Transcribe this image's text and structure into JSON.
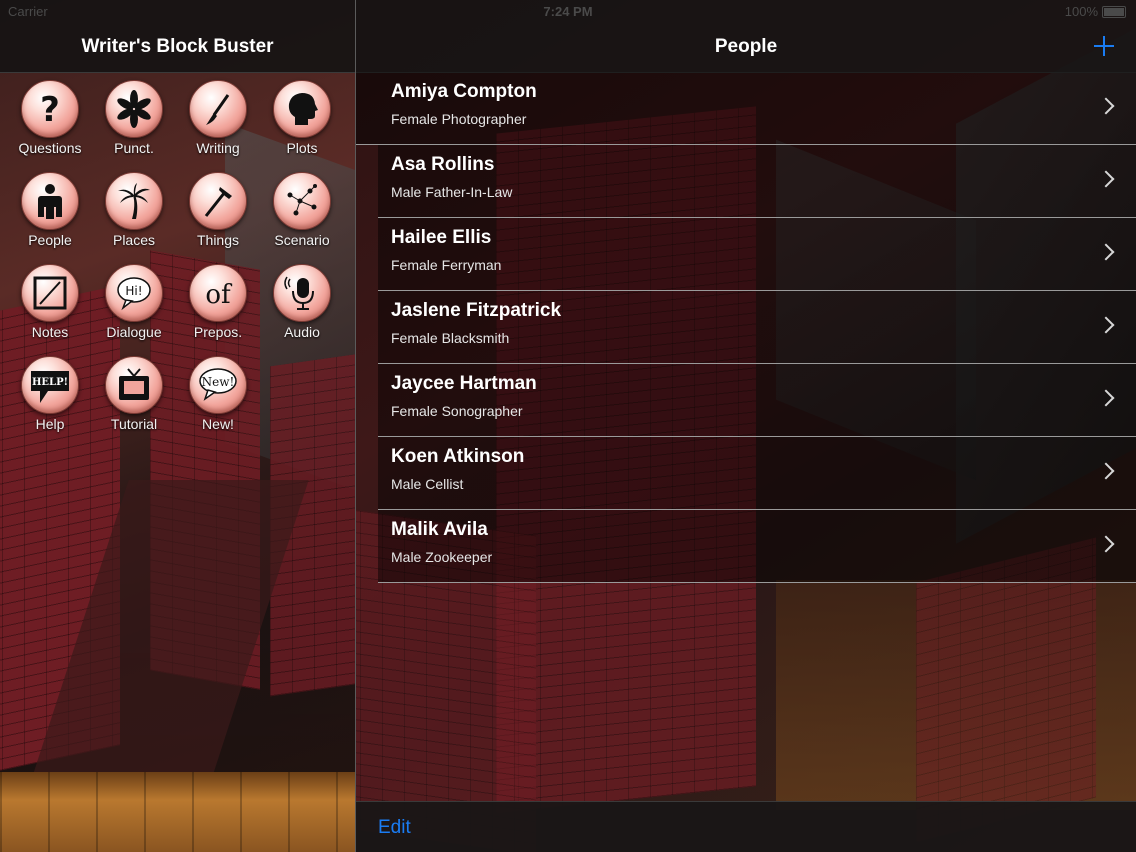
{
  "status_bar": {
    "carrier": "Carrier",
    "time": "7:24 PM",
    "battery": "100%"
  },
  "sidebar": {
    "title": "Writer's Block Buster",
    "items": [
      {
        "label": "Questions",
        "icon": "question-mark-icon"
      },
      {
        "label": "Punct.",
        "icon": "asterisk-icon"
      },
      {
        "label": "Writing",
        "icon": "paintbrush-icon"
      },
      {
        "label": "Plots",
        "icon": "head-silhouette-icon"
      },
      {
        "label": "People",
        "icon": "person-icon"
      },
      {
        "label": "Places",
        "icon": "palm-tree-icon"
      },
      {
        "label": "Things",
        "icon": "hammer-icon"
      },
      {
        "label": "Scenario",
        "icon": "constellation-icon"
      },
      {
        "label": "Notes",
        "icon": "notepad-pencil-icon"
      },
      {
        "label": "Dialogue",
        "icon": "speech-bubble-icon",
        "badge": "Hi!"
      },
      {
        "label": "Prepos.",
        "icon": "preposition-of-icon",
        "badge": "of"
      },
      {
        "label": "Audio",
        "icon": "microphone-icon"
      },
      {
        "label": "Help",
        "icon": "help-sign-icon",
        "badge": "HELP!"
      },
      {
        "label": "Tutorial",
        "icon": "tv-icon"
      },
      {
        "label": "New!",
        "icon": "new-bubble-icon",
        "badge": "New!"
      }
    ]
  },
  "main": {
    "title": "People",
    "add_button": "add-icon",
    "people": [
      {
        "name": "Amiya Compton",
        "description": "Female Photographer"
      },
      {
        "name": "Asa Rollins",
        "description": "Male Father-In-Law"
      },
      {
        "name": "Hailee Ellis",
        "description": "Female Ferryman"
      },
      {
        "name": "Jaslene Fitzpatrick",
        "description": "Female Blacksmith"
      },
      {
        "name": "Jaycee Hartman",
        "description": "Female Sonographer"
      },
      {
        "name": "Koen Atkinson",
        "description": "Male Cellist"
      },
      {
        "name": "Malik Avila",
        "description": "Male Zookeeper"
      }
    ],
    "toolbar": {
      "edit_label": "Edit"
    }
  },
  "colors": {
    "accent": "#1a7cf2",
    "icon_pink": "#f2a59c"
  }
}
